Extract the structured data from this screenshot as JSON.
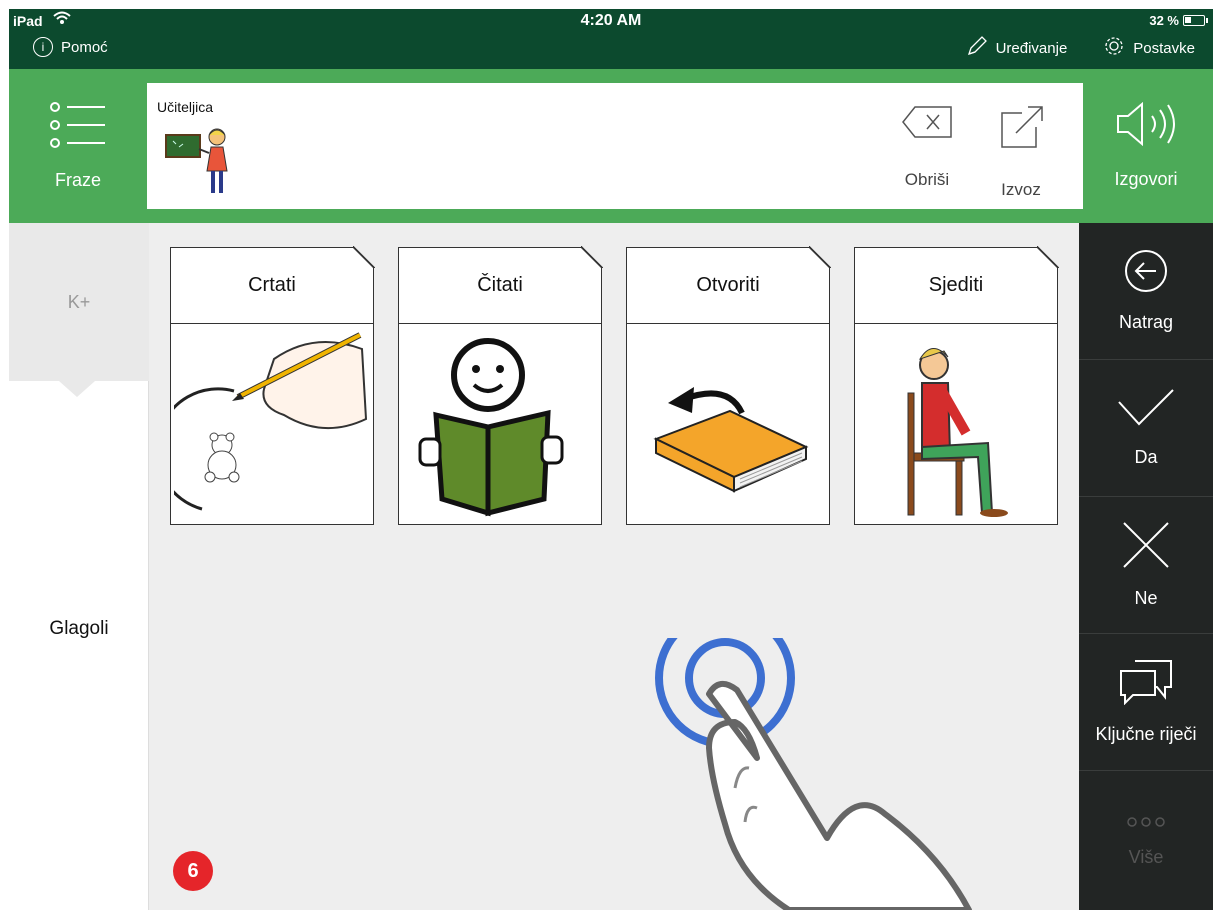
{
  "status": {
    "device": "iPad",
    "time": "4:20 AM",
    "battery": "32 %"
  },
  "topbar": {
    "help": "Pomoć",
    "edit": "Uređivanje",
    "settings": "Postavke"
  },
  "phrases_button": "Fraze",
  "message": {
    "label": "Učiteljica"
  },
  "message_actions": {
    "delete": "Obriši",
    "export": "Izvoz"
  },
  "speak_button": "Izgovori",
  "left": {
    "category_top": "K+",
    "category": "Glagoli"
  },
  "cards": [
    {
      "label": "Crtati"
    },
    {
      "label": "Čitati"
    },
    {
      "label": "Otvoriti"
    },
    {
      "label": "Sjediti"
    }
  ],
  "badge": "6",
  "right": [
    {
      "label": "Natrag",
      "icon": "back-arrow-circle-icon"
    },
    {
      "label": "Da",
      "icon": "checkmark-icon"
    },
    {
      "label": "Ne",
      "icon": "x-mark-icon"
    },
    {
      "label": "Ključne riječi",
      "icon": "speech-bubbles-icon"
    },
    {
      "label": "Više",
      "icon": "more-dots-icon"
    }
  ],
  "colors": {
    "dark_green": "#0c4a2e",
    "green": "#4caa58",
    "badge_red": "#e5252a",
    "touch_blue": "#3d6fd1"
  }
}
